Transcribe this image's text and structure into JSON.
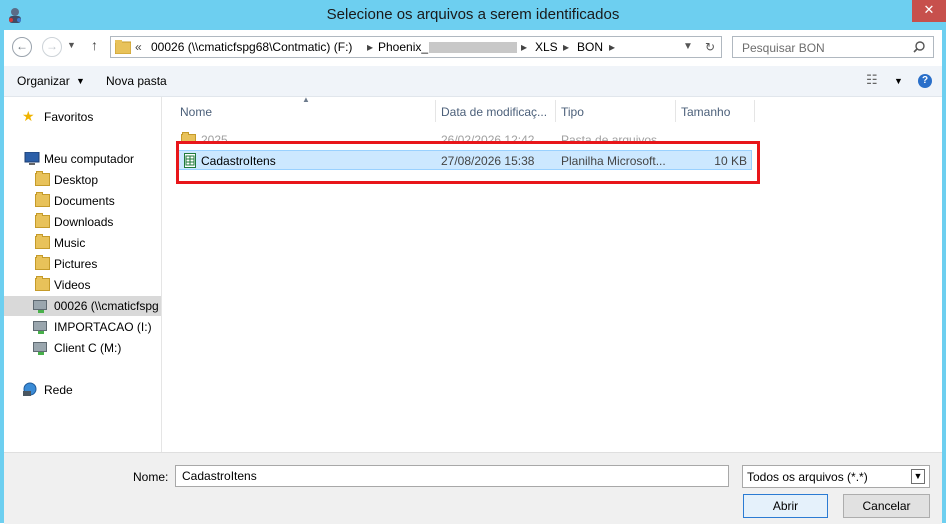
{
  "window": {
    "title": "Selecione os arquivos a serem identificados",
    "close_glyph": "✕"
  },
  "nav": {
    "back_icon": "arrow-left-icon",
    "forward_icon": "arrow-right-icon",
    "up_icon": "arrow-up-icon",
    "breadcrumb": [
      "00026 (\\\\cmaticfspg68\\Contmatic) (F:)",
      "Phoenix_",
      "XLS",
      "BON"
    ],
    "overflow_glyph": "«"
  },
  "search": {
    "placeholder": "Pesquisar BON"
  },
  "toolbar": {
    "organize": "Organizar",
    "new_folder": "Nova pasta"
  },
  "sidebar": {
    "favorites": "Favoritos",
    "computer": "Meu computador",
    "items": [
      "Desktop",
      "Documents",
      "Downloads",
      "Music",
      "Pictures",
      "Videos"
    ],
    "drives": [
      "00026 (\\\\cmaticfspg",
      "IMPORTACAO (I:)",
      "Client C (M:)"
    ],
    "network": "Rede"
  },
  "columns": {
    "name": "Nome",
    "modified": "Data de modificaç...",
    "type": "Tipo",
    "size": "Tamanho"
  },
  "files": [
    {
      "name": "2025",
      "modified": "26/02/2026 12:42",
      "type": "Pasta de arquivos",
      "size": ""
    },
    {
      "name": "CadastroItens",
      "modified": "27/08/2026 15:38",
      "type": "Planilha Microsoft...",
      "size": "10 KB"
    }
  ],
  "footer": {
    "name_label": "Nome:",
    "name_value": "CadastroItens",
    "filter": "Todos os arquivos (*.*)",
    "open": "Abrir",
    "cancel": "Cancelar"
  },
  "colors": {
    "titlebar": "#6dcff0",
    "highlight": "#e8161a",
    "selection": "#cce8ff"
  }
}
